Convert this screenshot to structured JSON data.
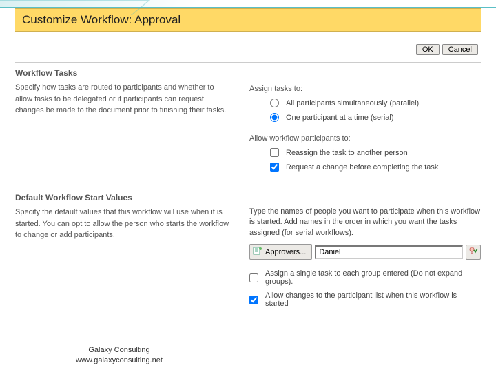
{
  "title_bar": "Customize Workflow: Approval",
  "buttons": {
    "ok": "OK",
    "cancel": "Cancel"
  },
  "section1": {
    "heading": "Workflow Tasks",
    "desc": "Specify how tasks are routed to participants and whether to allow tasks to be delegated or if participants can request changes be made to the document prior to finishing their tasks.",
    "assign_label": "Assign tasks to:",
    "opt_parallel": "All participants simultaneously (parallel)",
    "opt_serial": "One participant at a time (serial)",
    "allow_label": "Allow workflow participants to:",
    "chk_reassign": "Reassign the task to another person",
    "chk_request": "Request a change before completing the task"
  },
  "section2": {
    "heading": "Default Workflow Start Values",
    "desc": "Specify the default values that this workflow will use when it is started. You can opt to allow the person who starts the workflow to change or add participants.",
    "instr": "Type the names of people you want to participate when this workflow is started.  Add names in the order in which you want the tasks assigned (for serial workflows).",
    "approvers_btn": "Approvers...",
    "name_value": "Daniel",
    "chk_single": "Assign a single task to each group entered (Do not expand groups).",
    "chk_allowchg": "Allow changes to the participant list when this workflow is started"
  },
  "footer": {
    "line1": "Galaxy Consulting",
    "line2": "www.galaxyconsulting.net"
  },
  "colors": {
    "accent": "#ffd966"
  }
}
